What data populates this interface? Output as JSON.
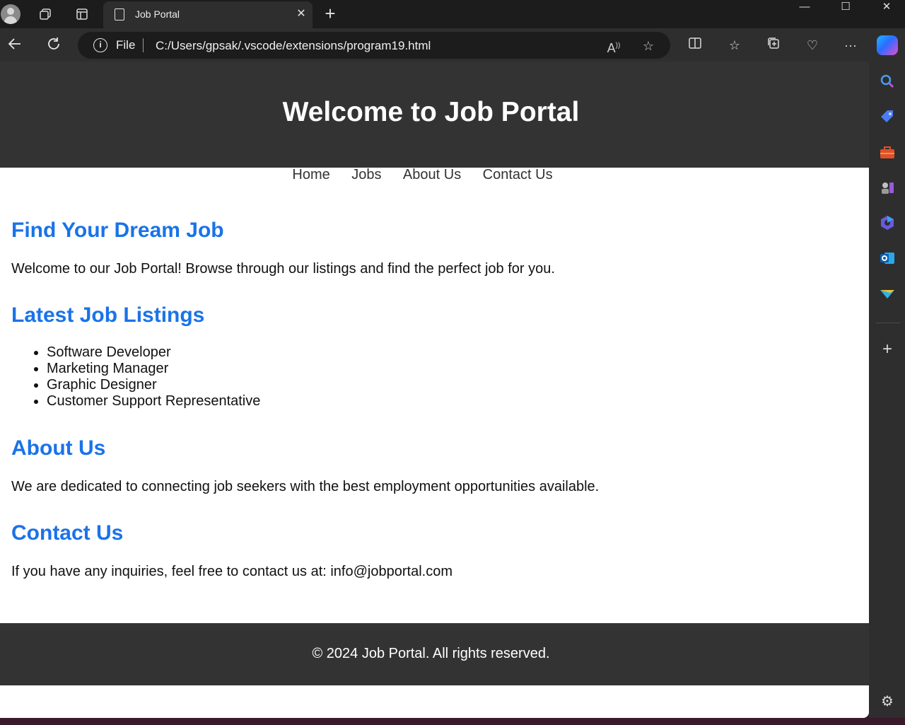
{
  "browser": {
    "tab": {
      "title": "Job Portal"
    },
    "address_bar": {
      "scheme_label": "File",
      "url": "C:/Users/gpsak/.vscode/extensions/program19.html"
    },
    "window_controls": {
      "minimize": "—",
      "maximize": "☐",
      "close": "✕"
    }
  },
  "page": {
    "header": {
      "title": "Welcome to Job Portal"
    },
    "nav": [
      "Home",
      "Jobs",
      "About Us",
      "Contact Us"
    ],
    "sections": {
      "dream_job": {
        "heading": "Find Your Dream Job",
        "text": "Welcome to our Job Portal! Browse through our listings and find the perfect job for you."
      },
      "listings": {
        "heading": "Latest Job Listings",
        "jobs": [
          "Software Developer",
          "Marketing Manager",
          "Graphic Designer",
          "Customer Support Representative"
        ]
      },
      "about": {
        "heading": "About Us",
        "text": "We are dedicated to connecting job seekers with the best employment opportunities available."
      },
      "contact": {
        "heading": "Contact Us",
        "text": "If you have any inquiries, feel free to contact us at: info@jobportal.com"
      }
    },
    "footer": {
      "text": "© 2024 Job Portal. All rights reserved."
    }
  },
  "colors": {
    "header_bg": "#333333",
    "heading_blue": "#1a73e8",
    "browser_dark": "#1c1c1c",
    "toolbar": "#2e2e2e"
  }
}
